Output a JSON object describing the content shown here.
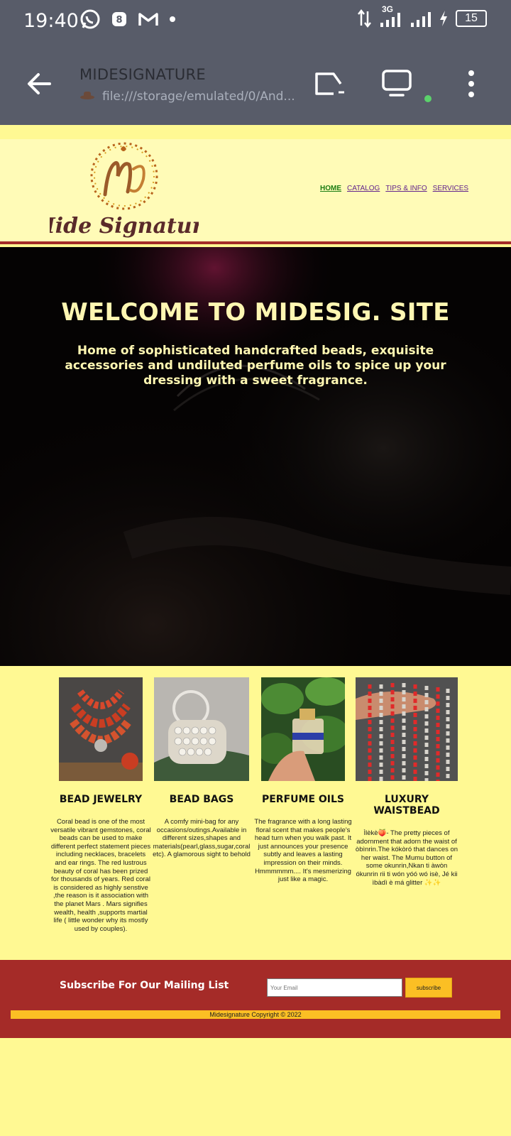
{
  "status_bar": {
    "time": "19:40",
    "network": "3G",
    "battery": "15"
  },
  "browser": {
    "title": "MIDESIGNATURE",
    "url": "file:///storage/emulated/0/And..."
  },
  "site": {
    "logo_text": "Mide Signature",
    "nav": [
      "HOME",
      "CATALOG",
      "TIPS & INFO",
      "SERVICES"
    ],
    "hero": {
      "title": "WELCOME TO MIDESIG. SITE",
      "subtitle": "Home of sophisticated handcrafted beads, exquisite accessories and undiluted perfume oils to spice up your dressing with a sweet fragrance."
    },
    "products": [
      {
        "title": "BEAD JEWELRY",
        "description": "Coral bead is one of the most versatile vibrant gemstones, coral beads can be used to make different perfect statement pieces including necklaces, bracelets and ear rings. The red lustrous beauty of coral has been prized for thousands of years. Red coral is considered as highly senstive ,the reason is it association with the planet Mars . Mars signifies wealth, health ,supports martial life ( little wonder why its mostly used by couples)."
      },
      {
        "title": "BEAD BAGS",
        "description": "A comfy mini-bag for any occasions/outings.Available in different sizes,shapes and materials(pearl,glass,sugar,coral etc). A glamorous sight to behold"
      },
      {
        "title": "PERFUME OILS",
        "description": "The fragrance with a long lasting floral scent that makes people's head turn when you walk past. It just announces your presence subtly and leaves a lasting impression on their minds. Hmmmmmm.... It's mesmerizing just like a magic."
      },
      {
        "title": "LUXURY WAISTBEAD",
        "description": "Ìlèkè🍑- The pretty pieces of adornment that adorn the waist of òbìnrin.The kókòró that dances on her waist. The Mumu button of some okunrin,Nkan ti àwòn ókunrin rii ti wón yóó wó isè, Jé kii ìbàdì è má glitter ✨✨"
      }
    ],
    "footer": {
      "subscribe_label": "Subscribe For Our Mailing List",
      "email_placeholder": "Your Email",
      "subscribe_button": "subscribe",
      "copyright": "Midesignature Copyright © 2022"
    }
  }
}
